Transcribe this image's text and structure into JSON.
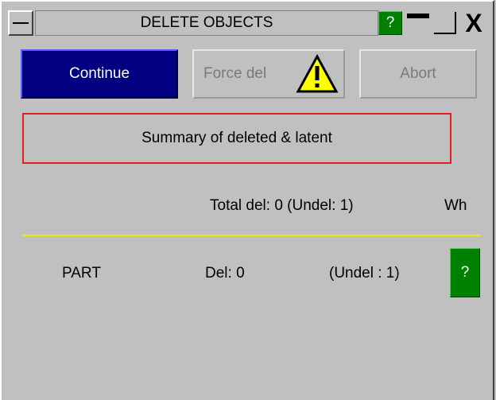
{
  "window": {
    "title": "DELETE OBJECTS",
    "help_label": "?",
    "close_label": "X"
  },
  "buttons": {
    "continue_label": "Continue",
    "force_label": "Force del",
    "abort_label": "Abort"
  },
  "summary": {
    "label": "Summary of deleted & latent"
  },
  "totals": {
    "text": "Total del: 0 (Undel: 1)",
    "wh_label": "Wh"
  },
  "rows": [
    {
      "type": "PART",
      "del": "Del: 0",
      "undel": "(Undel : 1)",
      "help": "?"
    }
  ],
  "colors": {
    "continue_bg": "#000080",
    "help_green": "#008000",
    "summary_border": "#e02020",
    "divider": "#e8e800"
  },
  "icons": {
    "warning": "warning-icon"
  }
}
